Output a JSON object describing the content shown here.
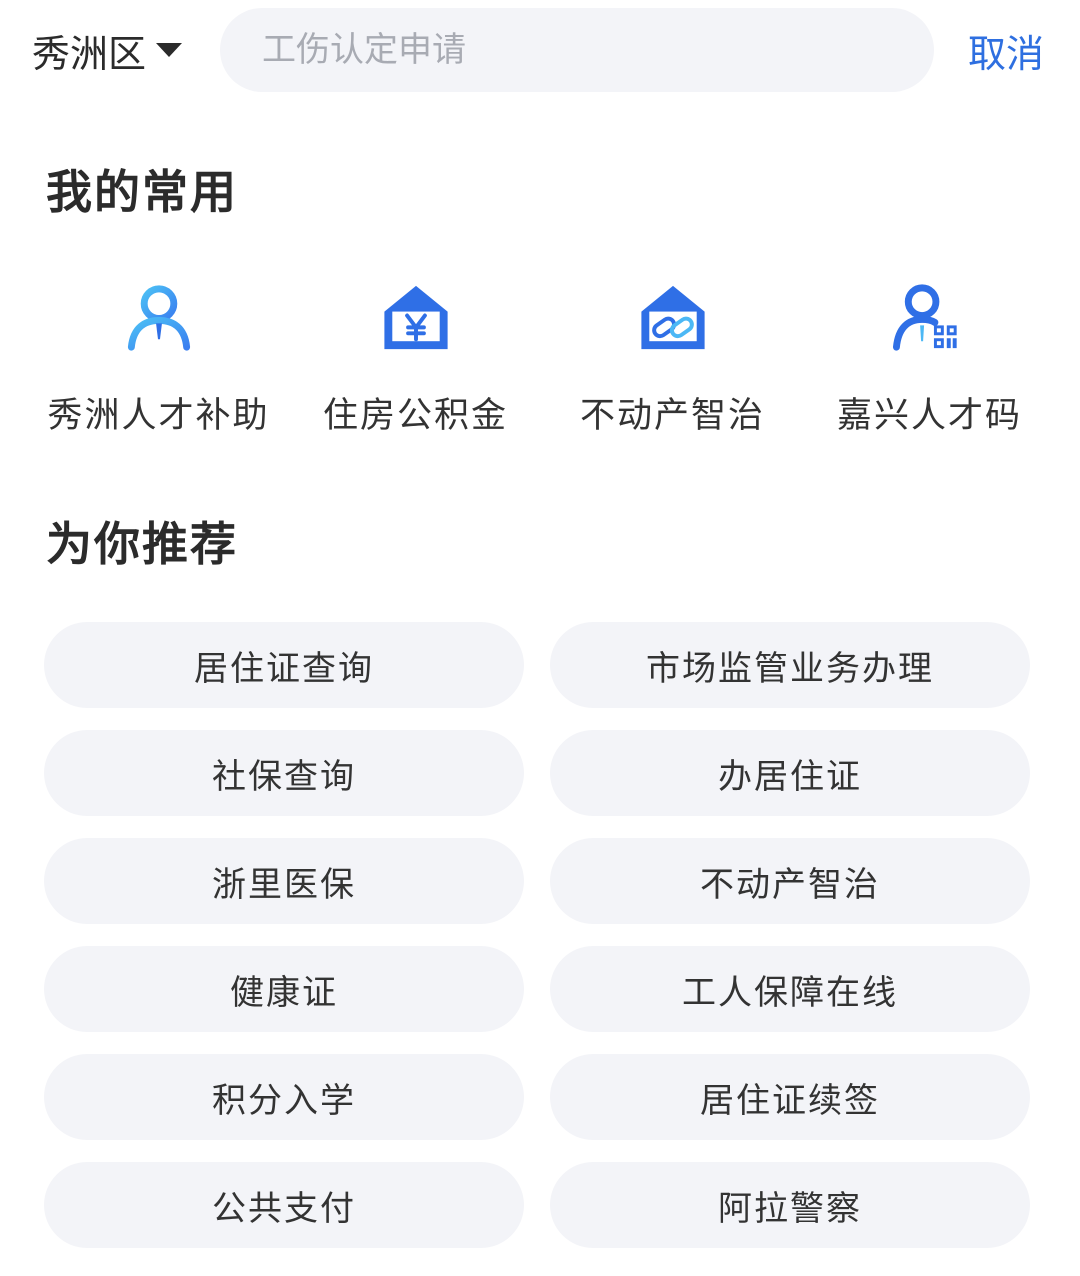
{
  "topbar": {
    "district": "秀洲区",
    "search_placeholder": "工伤认定申请",
    "cancel_label": "取消"
  },
  "favorites": {
    "title": "我的常用",
    "items": [
      {
        "label": "秀洲人才补助",
        "icon": "talent-person-icon"
      },
      {
        "label": "住房公积金",
        "icon": "house-yuan-icon"
      },
      {
        "label": "不动产智治",
        "icon": "house-link-icon"
      },
      {
        "label": "嘉兴人才码",
        "icon": "person-qrcode-icon"
      }
    ]
  },
  "recommend": {
    "title": "为你推荐",
    "items": [
      "居住证查询",
      "市场监管业务办理",
      "社保查询",
      "办居住证",
      "浙里医保",
      "不动产智治",
      "健康证",
      "工人保障在线",
      "积分入学",
      "居住证续签",
      "公共支付",
      "阿拉警察"
    ]
  },
  "colors": {
    "accent": "#2e6fe0",
    "pill_bg": "#f3f4f8",
    "icon_blue": "#2f6fe6",
    "icon_cyan": "#4cb8f5"
  }
}
